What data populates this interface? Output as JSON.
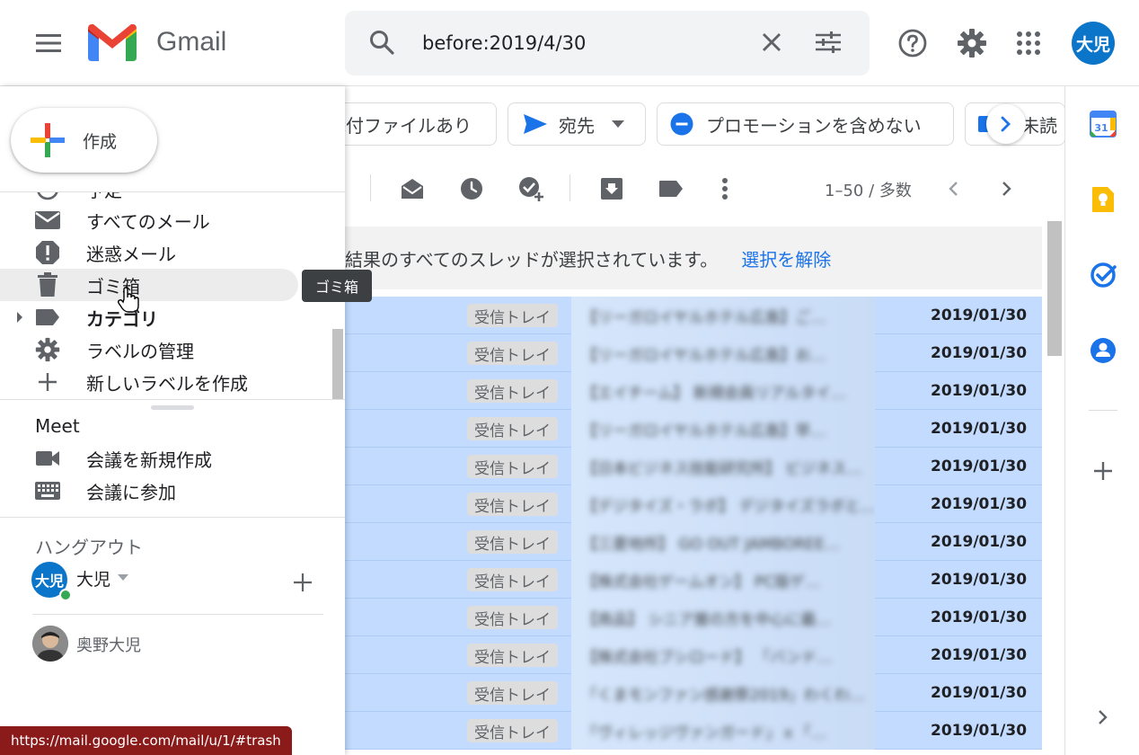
{
  "header": {
    "app_name": "Gmail",
    "search_value": "before:2019/4/30",
    "avatar_text": "大児"
  },
  "sidebar": {
    "compose_label": "作成",
    "partial_item": "予定",
    "items": [
      {
        "label": "すべてのメール",
        "icon": "mail-icon"
      },
      {
        "label": "迷惑メール",
        "icon": "spam-icon"
      },
      {
        "label": "ゴミ箱",
        "icon": "trash-icon"
      },
      {
        "label": "カテゴリ",
        "icon": "label-icon"
      },
      {
        "label": "ラベルの管理",
        "icon": "gear-icon"
      },
      {
        "label": "新しいラベルを作成",
        "icon": "plus-icon"
      }
    ],
    "meet": {
      "title": "Meet",
      "new_meeting": "会議を新規作成",
      "join_meeting": "会議に参加"
    },
    "hangouts": {
      "title": "ハングアウト",
      "user_avatar": "大児",
      "user_name": "大児",
      "contact_name": "奥野大児"
    }
  },
  "tooltip": "ゴミ箱",
  "status_url": "https://mail.google.com/mail/u/1/#trash",
  "chips": {
    "attachment": "添付ファイルあり",
    "to": "宛先",
    "no_promotions": "プロモーションを含めない",
    "unread": "未読"
  },
  "toolbar": {
    "pager": "1–50 / 多数"
  },
  "banner": {
    "text": "結果のすべてのスレッドが選択されています。",
    "link": "選択を解除"
  },
  "mail_rows": [
    {
      "label": "受信トレイ",
      "subject": "【リーガロイヤルホテル広島】ご…",
      "date": "2019/01/30"
    },
    {
      "label": "受信トレイ",
      "subject": "【リーガロイヤルホテル広島】お…",
      "date": "2019/01/30"
    },
    {
      "label": "受信トレイ",
      "subject": "【エイチーム】 新規会員リアルタイ…",
      "date": "2019/01/30"
    },
    {
      "label": "受信トレイ",
      "subject": "【リーガロイヤルホテル広島】早…",
      "date": "2019/01/30"
    },
    {
      "label": "受信トレイ",
      "subject": "【日本ビジネス技能研究所】 ビジネス…",
      "date": "2019/01/30"
    },
    {
      "label": "受信トレイ",
      "subject": "【デジタイズ・ラボ】 デジタイズラボと…",
      "date": "2019/01/30"
    },
    {
      "label": "受信トレイ",
      "subject": "【三菱地所】 GO OUT JAMBOREE…",
      "date": "2019/01/30"
    },
    {
      "label": "受信トレイ",
      "subject": "【株式会社ゲームオン】 PC版ゲ…",
      "date": "2019/01/30"
    },
    {
      "label": "受信トレイ",
      "subject": "【商品】 シニア層の方を中心に最…",
      "date": "2019/01/30"
    },
    {
      "label": "受信トレイ",
      "subject": "【株式会社ブシロード】 「バンド…",
      "date": "2019/01/30"
    },
    {
      "label": "受信トレイ",
      "subject": "「くまモンファン感謝祭2019」わくわ…",
      "date": "2019/01/30"
    },
    {
      "label": "受信トレイ",
      "subject": "「ヴィレッジヴァンガード」ｘ「…",
      "date": "2019/01/30"
    }
  ],
  "colors": {
    "selected_row": "#c2dbff",
    "link_blue": "#1a73e8",
    "avatar_blue": "#0b76c9",
    "status_bar": "#8b1a1a"
  },
  "side_panel": {
    "calendar_day": "31"
  }
}
